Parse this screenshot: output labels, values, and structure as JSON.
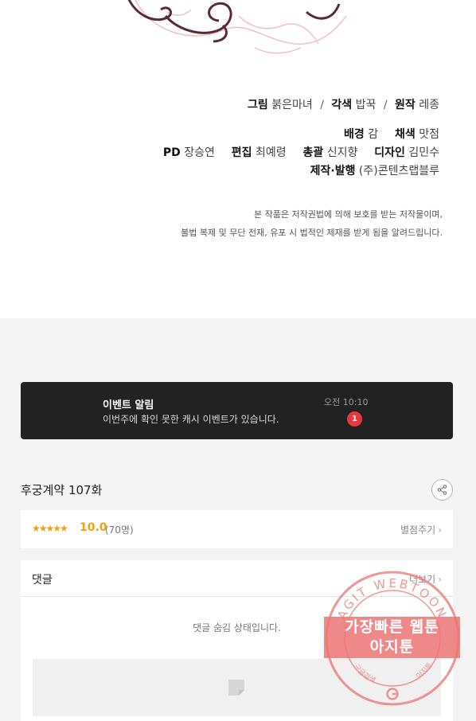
{
  "credits": {
    "line1": {
      "art_role": "그림",
      "art_name": "붉은마녀",
      "color_role": "각색",
      "color_name": "밥꾹",
      "original_role": "원작",
      "original_name": "레종"
    },
    "line2": {
      "bg_role": "배경",
      "bg_name": "감",
      "coloring_role": "채색",
      "coloring_name": "맛점"
    },
    "line3": {
      "pd_role": "PD",
      "pd_name": "장승연",
      "edit_role": "편집",
      "edit_name": "최예령",
      "chief_role": "총괄",
      "chief_name": "신지향",
      "design_role": "디자인",
      "design_name": "김민수"
    },
    "line4": {
      "produce_role": "제작·발행",
      "produce_name": "(주)콘텐츠랩블루"
    },
    "separator": "/"
  },
  "copyright_notice": {
    "line1": "본 작품은 저작권법에 의해 보호를 받는 저작물이며,",
    "line2": "불법 복제 및 무단 전재, 유포 시 법적인 제재를 받게 됨을 알려드립니다."
  },
  "event_banner": {
    "title": "이벤트 알림",
    "description": "이번주에 확인 못한 캐시 이벤트가 있습니다.",
    "time": "오전 10:10",
    "badge": "1"
  },
  "episode": {
    "title": "후궁계약 107화"
  },
  "rating": {
    "stars": "★★★★★",
    "star_value": 5,
    "score": "10.0",
    "count": "(70명)",
    "rate_label": "별점주기"
  },
  "comments": {
    "label": "댓글",
    "more_label": "더보기",
    "hidden_message": "댓글 숨김 상태입니다."
  },
  "watermark": {
    "ring_text": "AGIT WEBTOON",
    "banner_line1": "가장빠른 웹툰",
    "banner_line2": "아지툰",
    "bottom_left": "구글검색",
    "bottom_right": "아지툰"
  },
  "colors": {
    "accent_star": "#f2a10e",
    "badge_red": "#e8383d",
    "banner_bg": "#222222",
    "stamp_red": "#ec7474"
  }
}
